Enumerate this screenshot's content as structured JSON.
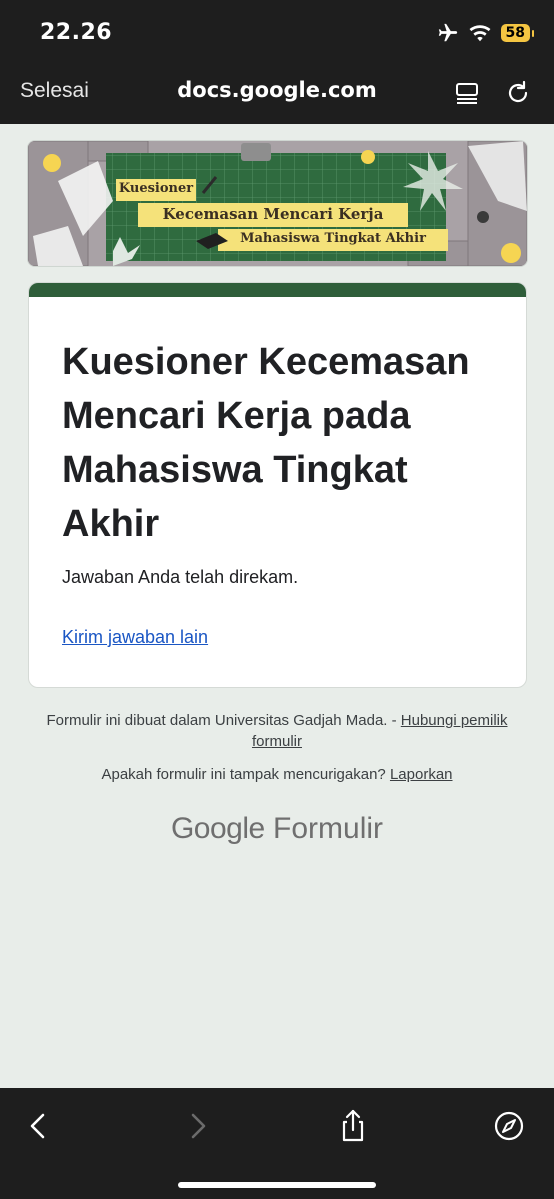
{
  "status": {
    "time": "22.26",
    "battery": "58"
  },
  "browser": {
    "done_label": "Selesai",
    "url": "docs.google.com"
  },
  "banner": {
    "line1": "Kuesioner",
    "line2": "Kecemasan Mencari Kerja",
    "line3": "Mahasiswa Tingkat Akhir"
  },
  "form": {
    "title": "Kuesioner Kecemasan Mencari Kerja pada Mahasiswa Tingkat Akhir",
    "confirmation": "Jawaban Anda telah direkam.",
    "submit_another": "Kirim jawaban lain"
  },
  "footer": {
    "created_text": "Formulir ini dibuat dalam Universitas Gadjah Mada. - ",
    "contact_link": "Hubungi pemilik formulir",
    "suspicious_text": "Apakah formulir ini tampak mencurigakan? ",
    "report_link": "Laporkan",
    "brand_google": "Google",
    "brand_product": "Formulir"
  },
  "colors": {
    "accent": "#2f5e3a",
    "link": "#1a56c4",
    "background": "#e8ede9"
  }
}
